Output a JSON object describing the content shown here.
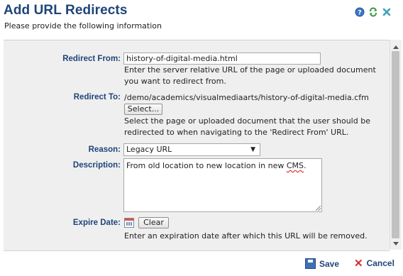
{
  "header": {
    "title": "Add URL Redirects",
    "subtitle": "Please provide the following information",
    "icons": [
      "help-icon",
      "refresh-icon",
      "close-icon"
    ]
  },
  "form": {
    "redirect_from": {
      "label": "Redirect From:",
      "value": "history-of-digital-media.html",
      "help": "Enter the server relative URL of the page or uploaded document you want to redirect from."
    },
    "redirect_to": {
      "label": "Redirect To:",
      "value": "/demo/academics/visualmediaarts/history-of-digital-media.cfm",
      "button": "Select...",
      "help": "Select the page or uploaded document that the user should be redirected to when navigating to the 'Redirect From' URL."
    },
    "reason": {
      "label": "Reason:",
      "selected": "Legacy URL"
    },
    "description": {
      "label": "Description:",
      "value_before": "From old location to new location in new ",
      "value_flagged": "CMS",
      "value_after": "."
    },
    "expire_date": {
      "label": "Expire Date:",
      "clear_button": "Clear",
      "help": "Enter an expiration date after which this URL will be removed."
    }
  },
  "footer": {
    "save_label": "Save",
    "cancel_label": "Cancel"
  },
  "colors": {
    "title": "#1f4479",
    "panel_bg": "#efefef",
    "cancel": "#d42b2b"
  }
}
